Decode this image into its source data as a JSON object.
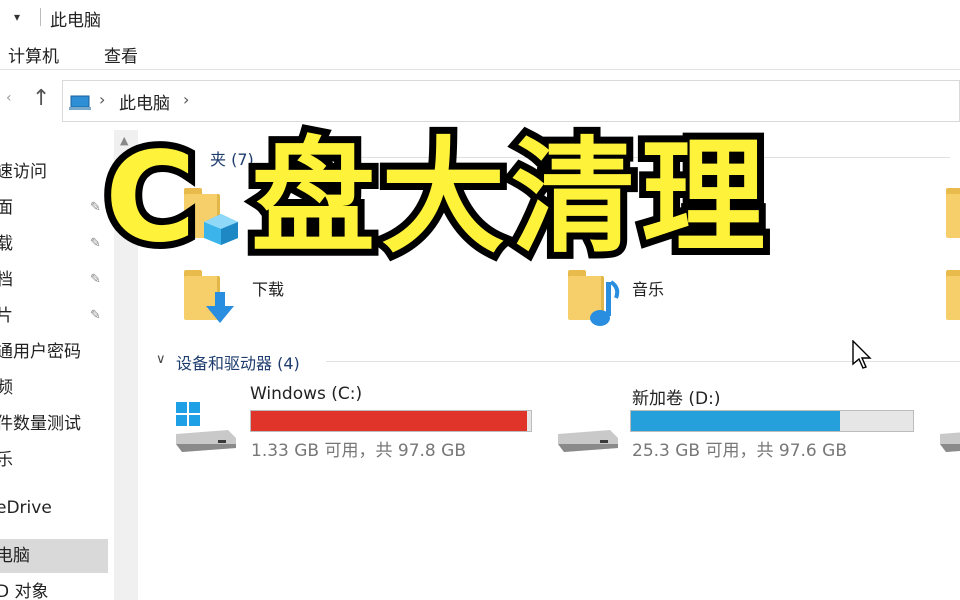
{
  "window": {
    "title": "此电脑",
    "quick_access_arrow": "▾"
  },
  "ribbon": {
    "tabs": [
      "计算机",
      "查看"
    ]
  },
  "nav": {
    "back_symbol": "‹",
    "up_symbol": "↑",
    "address": {
      "path_item": "此电脑",
      "chevron": "›"
    }
  },
  "sidebar": {
    "items": [
      {
        "label": "速访问",
        "pinned": false,
        "selected": false
      },
      {
        "label": "面",
        "pinned": true,
        "selected": false
      },
      {
        "label": "载",
        "pinned": true,
        "selected": false
      },
      {
        "label": "档",
        "pinned": true,
        "selected": false
      },
      {
        "label": "片",
        "pinned": true,
        "selected": false
      },
      {
        "label": "通用户密码",
        "pinned": false,
        "selected": false
      },
      {
        "label": "频",
        "pinned": false,
        "selected": false
      },
      {
        "label": "件数量测试",
        "pinned": false,
        "selected": false
      },
      {
        "label": "乐",
        "pinned": false,
        "selected": false
      },
      {
        "label": "eDrive",
        "pinned": false,
        "selected": false
      },
      {
        "label": "电脑",
        "pinned": false,
        "selected": true
      },
      {
        "label": "D 对象",
        "pinned": false,
        "selected": false
      }
    ],
    "pin_symbol": "📌"
  },
  "content": {
    "folders_section": {
      "heading": "夹 (7)",
      "folders": [
        {
          "label": "",
          "overlay_icon": "3d-objects-icon"
        },
        {
          "label": "下载",
          "overlay_icon": "download-arrow-icon"
        },
        {
          "label": "音乐",
          "overlay_icon": "music-note-icon"
        }
      ]
    },
    "drives_section": {
      "heading": "设备和驱动器 (4)",
      "chevron": "∨",
      "drives": [
        {
          "name": "Windows (C:)",
          "info": "1.33 GB 可用，共 97.8 GB",
          "used_fraction": 0.986,
          "bar_color": "#e0342a",
          "icon": "windows-drive-icon"
        },
        {
          "name": "新加卷 (D:)",
          "info": "25.3 GB 可用，共 97.6 GB",
          "used_fraction": 0.74,
          "bar_color": "#26a0da",
          "icon": "drive-icon"
        }
      ]
    }
  },
  "overlay": {
    "caption": "C 盘大清理",
    "text_color": "#fff23a",
    "stroke_color": "#000000"
  }
}
